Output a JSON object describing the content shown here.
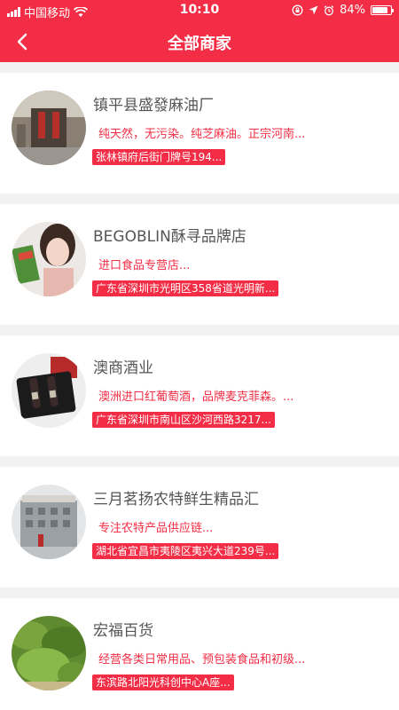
{
  "status_bar": {
    "carrier": "中国移动",
    "time": "10:10",
    "battery_text": "84%",
    "battery_level": 0.84
  },
  "header": {
    "title": "全部商家",
    "color": "#f22d45"
  },
  "stores": [
    {
      "name": "镇平县盛發麻油厂",
      "description": "纯天然，无污染。纯芝麻油。正宗河南...",
      "address": "张林镇府后街门牌号194..."
    },
    {
      "name": "BEGOBLIN酥寻品牌店",
      "description": "进口食品专营店...",
      "address": "广东省深圳市光明区358省道光明新..."
    },
    {
      "name": "澳商酒业",
      "description": "澳洲进口红葡萄酒，品牌麦克菲森。...",
      "address": "广东省深圳市南山区沙河西路3217..."
    },
    {
      "name": "三月茗扬农特鲜生精品汇",
      "description": "专注农特产品供应链...",
      "address": "湖北省宜昌市夷陵区夷兴大道239号..."
    },
    {
      "name": "宏福百货",
      "description": "经营各类日常用品、预包装食品和初级...",
      "address": "东滨路北阳光科创中心A座..."
    }
  ]
}
